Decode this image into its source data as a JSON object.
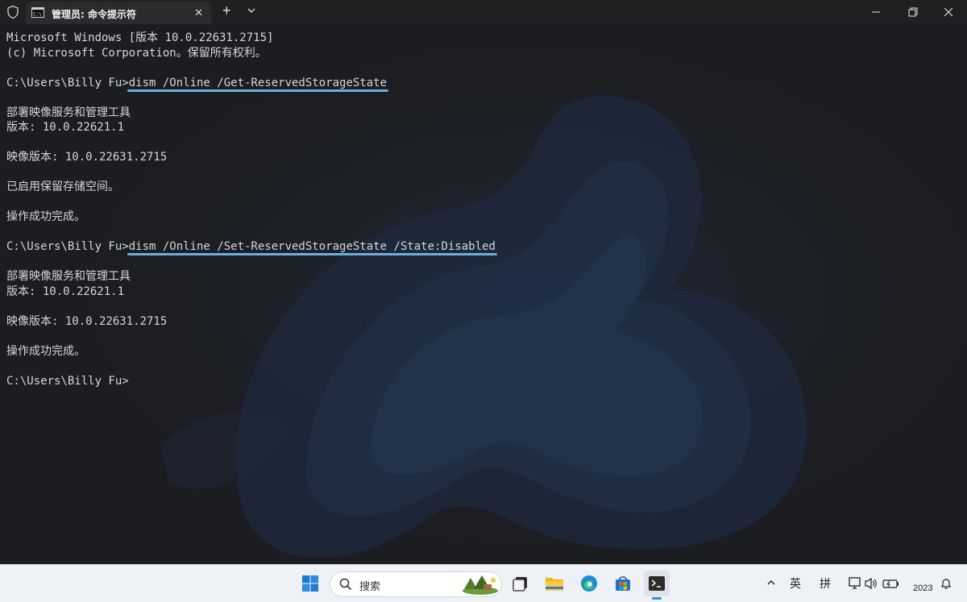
{
  "titlebar": {
    "tab_title": "管理员: 命令提示符",
    "close_tab": "✕",
    "new_tab": "+"
  },
  "terminal": {
    "lines": [
      {
        "text": "Microsoft Windows [版本 10.0.22631.2715]"
      },
      {
        "text": "(c) Microsoft Corporation。保留所有权利。"
      },
      {
        "text": ""
      },
      {
        "prompt": "C:\\Users\\Billy Fu>",
        "command": "dism /Online /Get-ReservedStorageState",
        "highlight": true
      },
      {
        "text": ""
      },
      {
        "text": "部署映像服务和管理工具"
      },
      {
        "text": "版本: 10.0.22621.1"
      },
      {
        "text": ""
      },
      {
        "text": "映像版本: 10.0.22631.2715"
      },
      {
        "text": ""
      },
      {
        "text": "已启用保留存储空间。"
      },
      {
        "text": ""
      },
      {
        "text": "操作成功完成。"
      },
      {
        "text": ""
      },
      {
        "prompt": "C:\\Users\\Billy Fu>",
        "command": "dism /Online /Set-ReservedStorageState /State:Disabled",
        "highlight": true
      },
      {
        "text": ""
      },
      {
        "text": "部署映像服务和管理工具"
      },
      {
        "text": "版本: 10.0.22621.1"
      },
      {
        "text": ""
      },
      {
        "text": "映像版本: 10.0.22631.2715"
      },
      {
        "text": ""
      },
      {
        "text": "操作成功完成。"
      },
      {
        "text": ""
      },
      {
        "prompt": "C:\\Users\\Billy Fu>",
        "command": ""
      }
    ],
    "highlight_color": "#6aaee0"
  },
  "taskbar": {
    "search_label": "搜索",
    "ime_lang": "英",
    "ime_mode": "拼",
    "clock_year": "2023",
    "icons": [
      "windows-start-icon",
      "search-icon",
      "task-view-icon",
      "file-explorer-icon",
      "edge-icon",
      "store-icon",
      "terminal-icon",
      "chevron-up-icon",
      "network-icon",
      "volume-icon",
      "battery-icon",
      "bell-icon"
    ]
  }
}
